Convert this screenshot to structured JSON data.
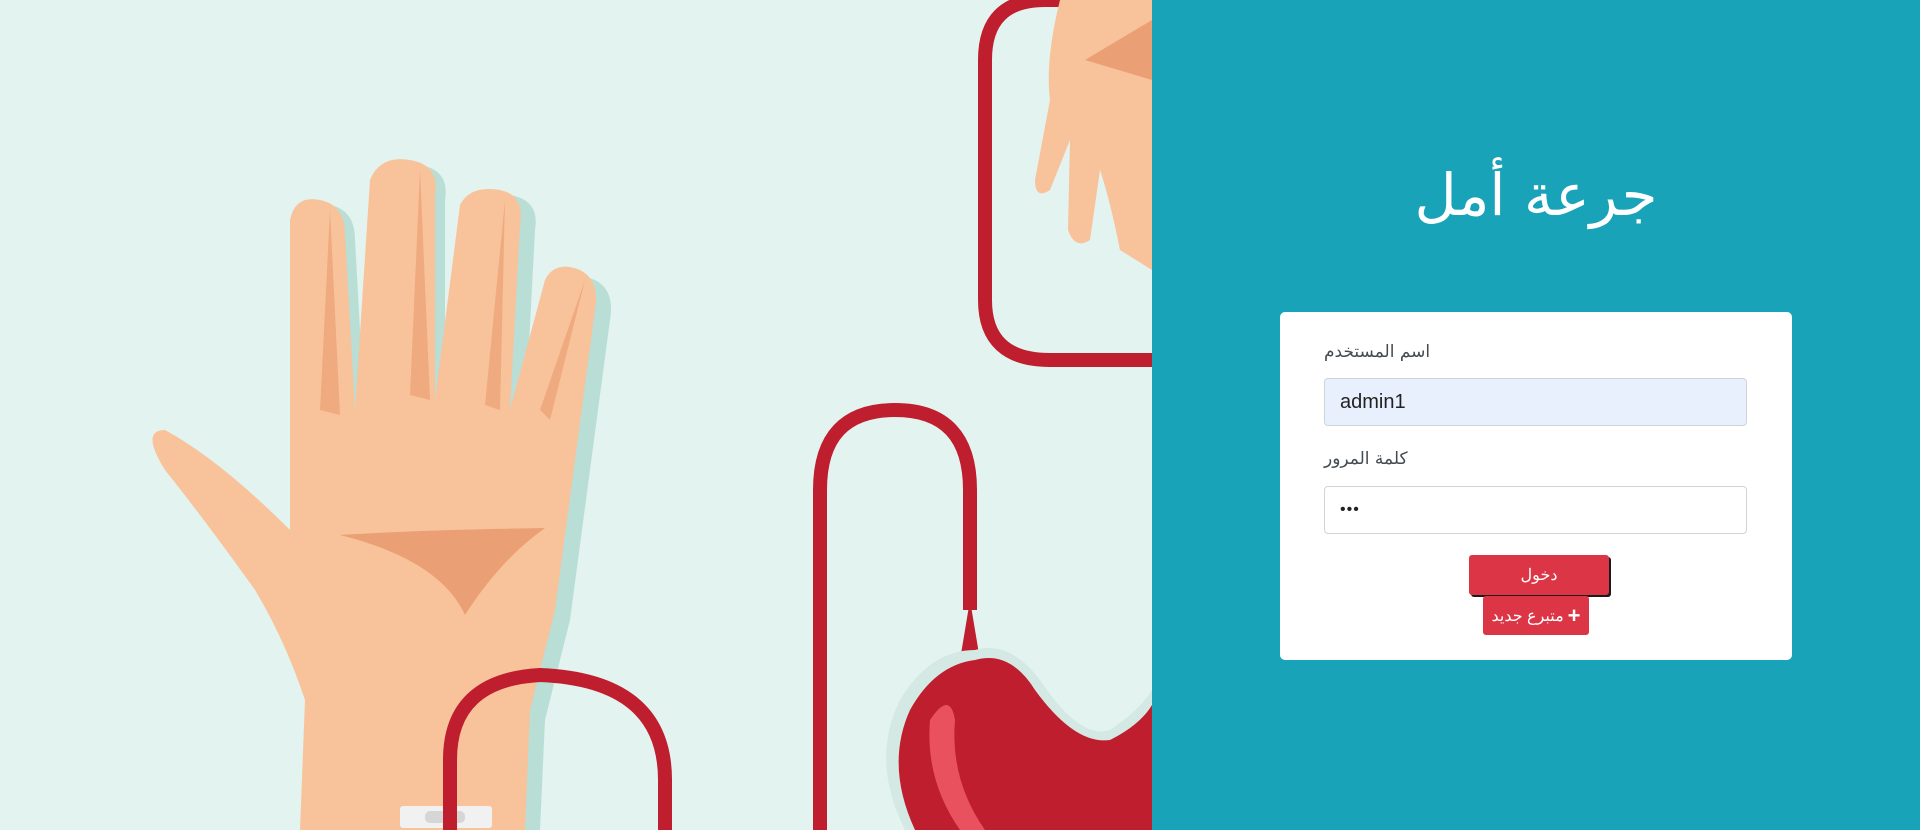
{
  "app": {
    "title": "جرعة أمل"
  },
  "login_form": {
    "username_label": "اسم المستخدم",
    "username_value": "admin1",
    "password_label": "كلمة المرور",
    "password_value": "•••",
    "login_button": "دخول",
    "register_button": "متبرع جديد",
    "register_icon": "plus-icon"
  },
  "colors": {
    "panel_teal": "#19a3b9",
    "button_red": "#dc3545",
    "illustration_bg": "#e3f3ef",
    "blood_red": "#be1e2d",
    "skin": "#f8c39a",
    "skin_shadow": "#eb9f74"
  }
}
